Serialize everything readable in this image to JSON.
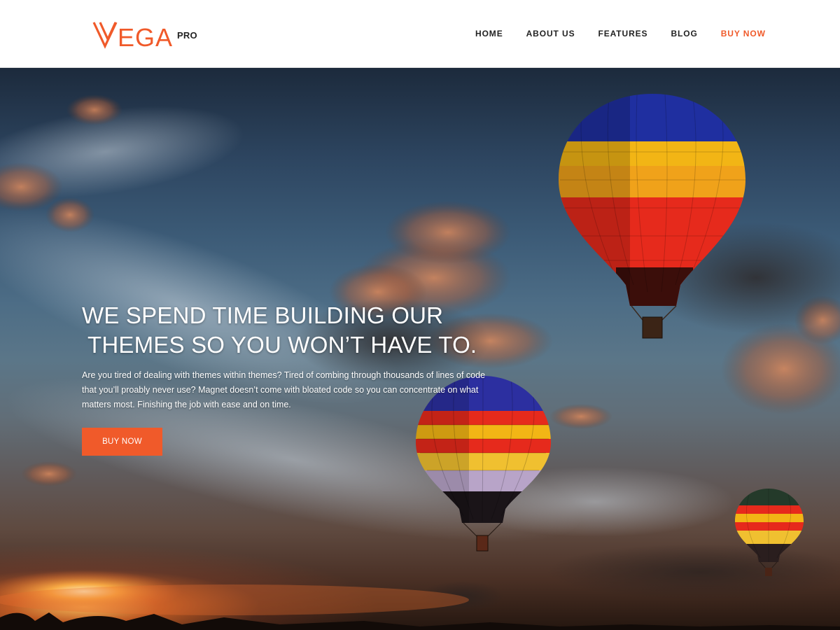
{
  "header": {
    "logo_text": "VEGA",
    "logo_badge": "PRO",
    "nav": [
      {
        "label": "HOME"
      },
      {
        "label": "ABOUT US"
      },
      {
        "label": "FEATURES"
      },
      {
        "label": "BLOG"
      },
      {
        "label": "BUY NOW"
      }
    ]
  },
  "hero": {
    "title_line1": "WE SPEND TIME BUILDING OUR",
    "title_line2": "THEMES SO YOU WON’T HAVE TO.",
    "description": "Are you tired of dealing with themes within themes? Tired of combing through thousands of lines of code that you’ll proably never use? Magnet doesn’t come with bloated code so you can concentrate on what matters most. Finishing the job with ease and on time.",
    "button_label": "BUY NOW",
    "background_image": "hot-air-balloons-sunset-sky"
  },
  "colors": {
    "accent": "#f05a2a",
    "nav_text": "#222222",
    "header_bg": "#ffffff",
    "hero_text": "#ffffff"
  }
}
